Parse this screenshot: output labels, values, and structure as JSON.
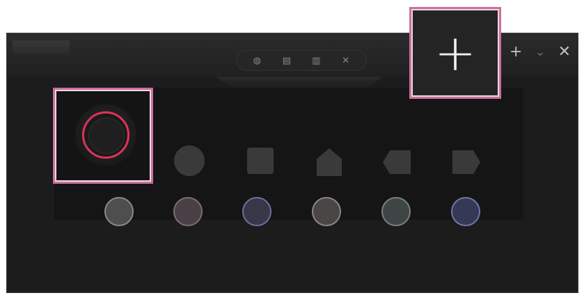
{
  "toolbar": {
    "icons": [
      {
        "name": "record-icon",
        "glyph": "◍"
      },
      {
        "name": "document-icon",
        "glyph": "▤"
      },
      {
        "name": "trash-icon",
        "glyph": "▥"
      },
      {
        "name": "close-small-icon",
        "glyph": "✕"
      }
    ]
  },
  "window_controls": {
    "add": "+",
    "collapse": "⌄",
    "close": "✕"
  },
  "add_button": {
    "label": "+"
  },
  "shapes_row": [
    {
      "name": "shape-circle",
      "kind": "circle"
    },
    {
      "name": "shape-square",
      "kind": "square"
    },
    {
      "name": "shape-pentagon",
      "kind": "pentagon"
    },
    {
      "name": "shape-arrow-left",
      "kind": "tag-left"
    },
    {
      "name": "shape-arrow-right",
      "kind": "tag-right"
    }
  ],
  "color_swatches": [
    {
      "name": "swatch-gray",
      "fill": "#4e4e4e",
      "border": "#8a8a8a"
    },
    {
      "name": "swatch-mauve",
      "fill": "#4a3f44",
      "border": "#7e6b74"
    },
    {
      "name": "swatch-indigo",
      "fill": "#36384a",
      "border": "#6e6f97"
    },
    {
      "name": "swatch-taupe",
      "fill": "#4b4646",
      "border": "#8c8585"
    },
    {
      "name": "swatch-slate",
      "fill": "#3e4544",
      "border": "#778180"
    },
    {
      "name": "swatch-navy",
      "fill": "#353955",
      "border": "#6f76a6"
    }
  ],
  "accent_color": "#e0325a",
  "highlight_color": "#c8729b"
}
